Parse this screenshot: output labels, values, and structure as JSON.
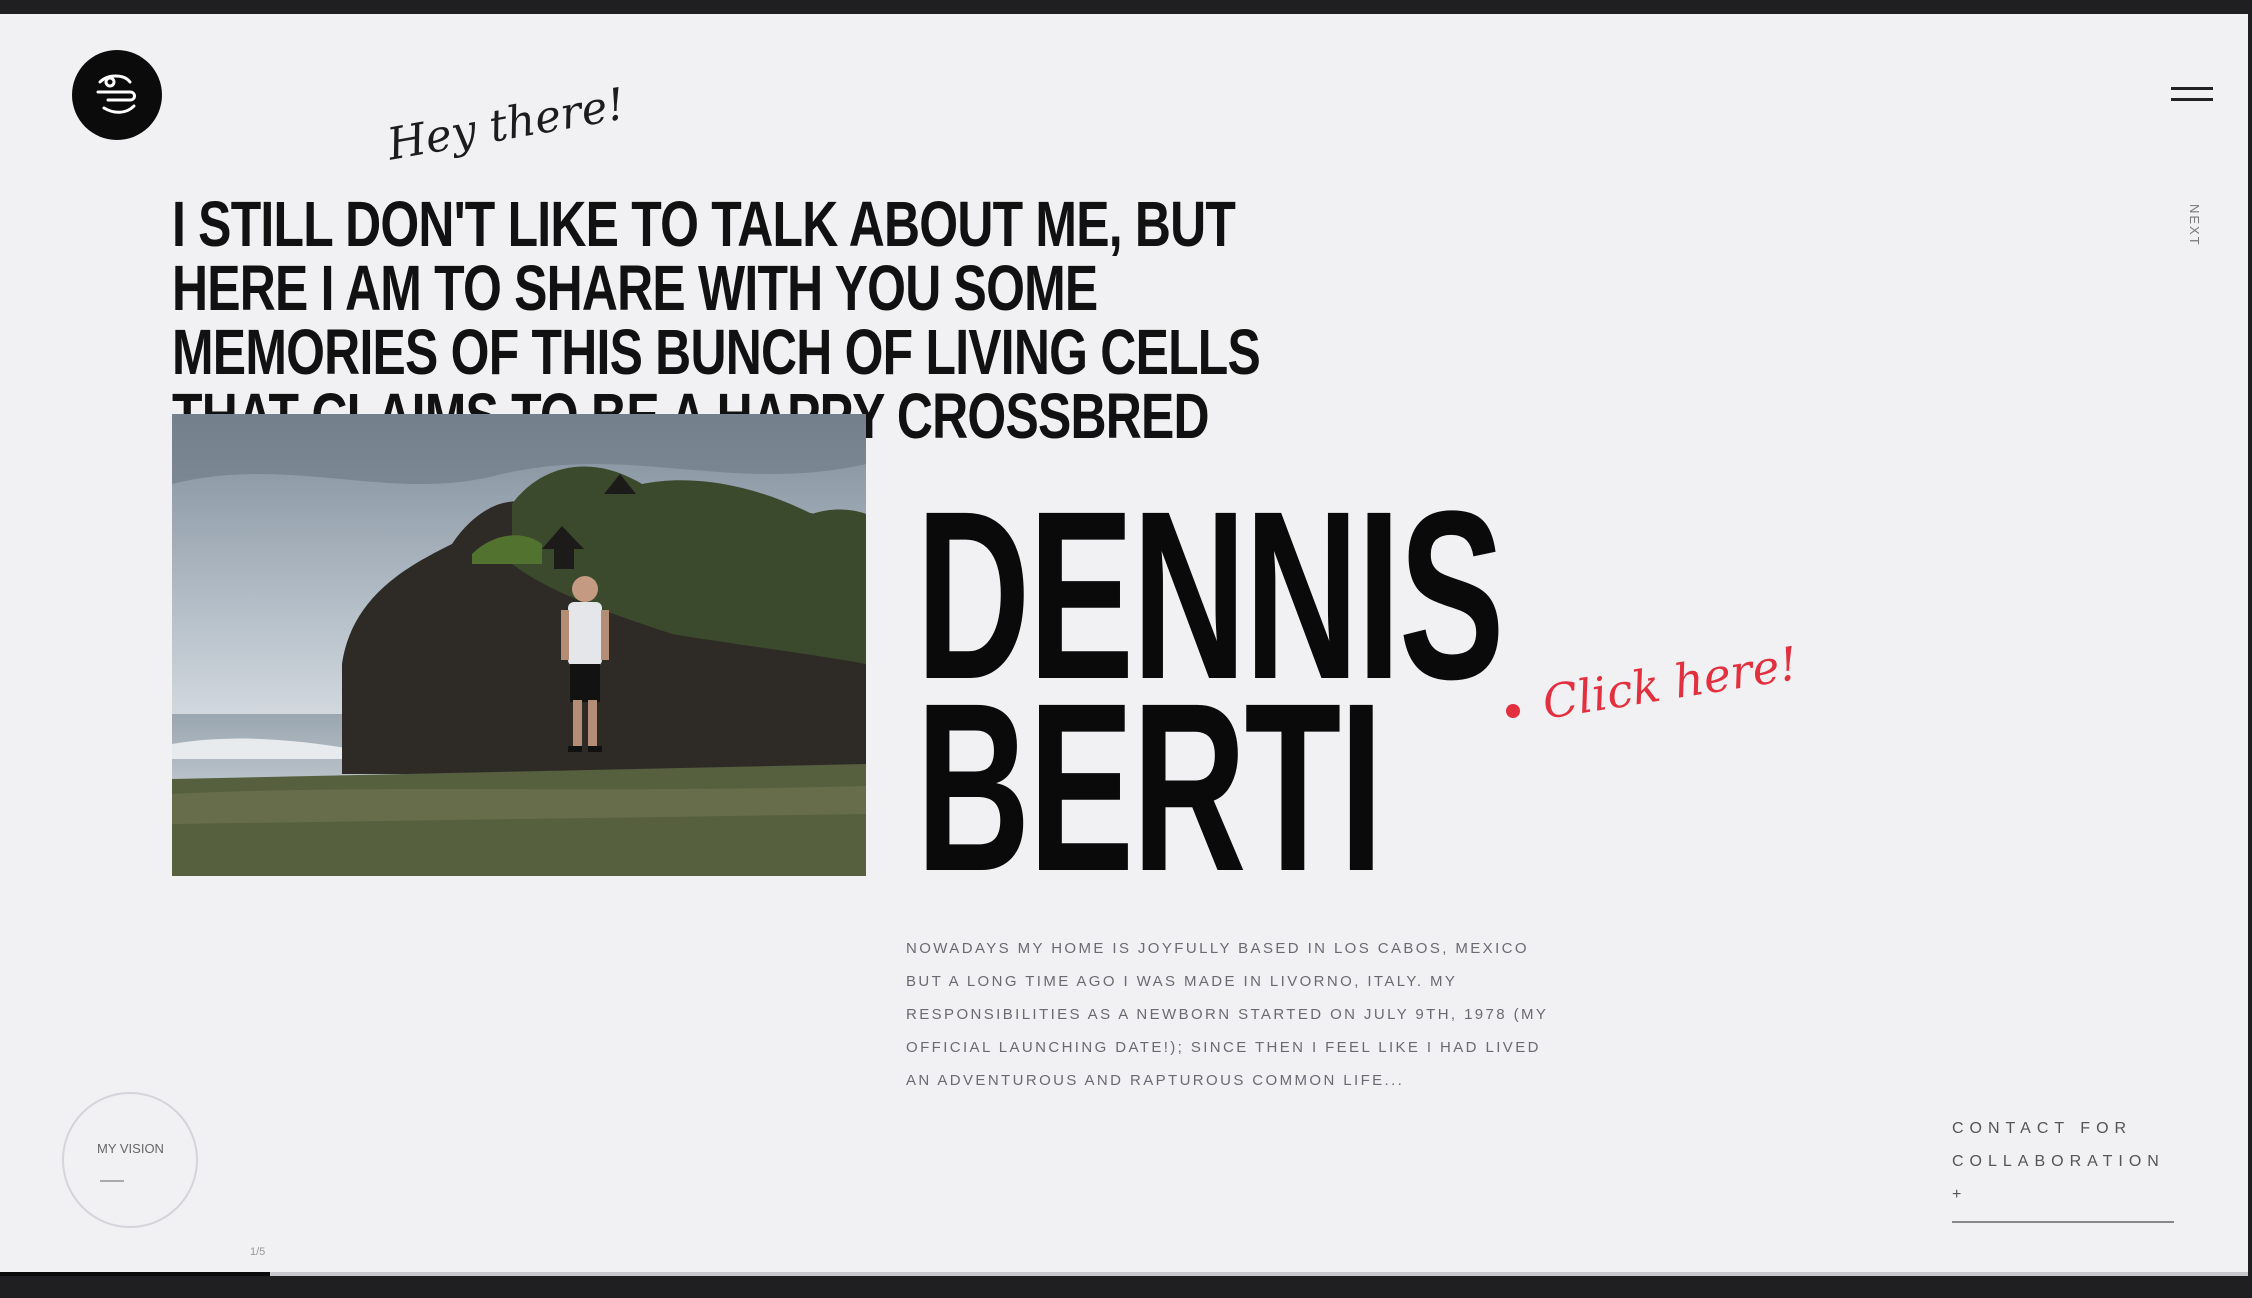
{
  "header": {
    "logo_icon": "brand-logo-icon",
    "menu_icon": "hamburger-menu-icon",
    "side_label": "NEXT"
  },
  "intro": {
    "greeting": "Hey there!",
    "text": "I still don't like to talk about me, but here I am to share with you some memories of this bunch of living cells that claims to be a happy crossbred photographer named"
  },
  "profile": {
    "first_name": "DENNIS",
    "last_name": "BERTI",
    "click_label": "Click here!",
    "bio": "Nowadays my home is joyfully based in Los Cabos, Mexico but a long time ago I was made in Livorno, Italy. My responsibilities as a newborn started on July 9th, 1978 (my official launching date!); since then I feel like I had lived an adventurous and rapturous common life..."
  },
  "footer": {
    "vision_label": "MY VISION",
    "contact_label": "CONTACT FOR COLLABORATION +",
    "page_indicator": "1/5",
    "progress": 0.12
  },
  "colors": {
    "accent": "#e3303f",
    "text": "#111111",
    "background": "#f1f0f3"
  }
}
